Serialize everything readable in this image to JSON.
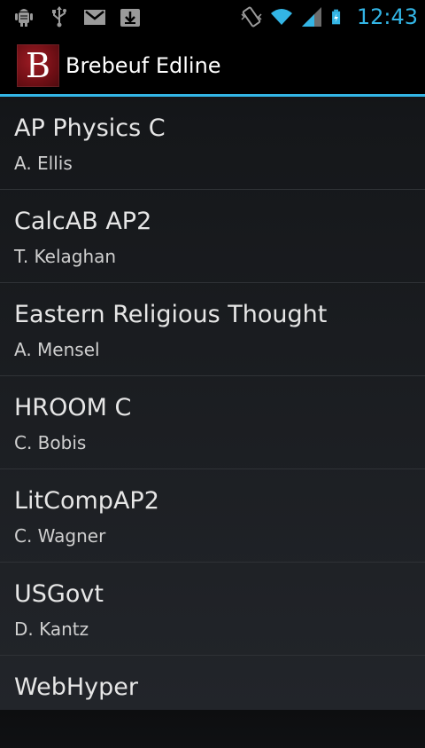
{
  "status_bar": {
    "icons_left": [
      "android-debug-icon",
      "usb-icon",
      "gmail-icon",
      "download-icon"
    ],
    "icons_right": [
      "vibrate-icon",
      "wifi-icon",
      "signal-icon",
      "battery-charging-icon"
    ],
    "time": "12:43",
    "accent_color": "#33b5e5"
  },
  "action_bar": {
    "logo_letter": "B",
    "title": "Brebeuf Edline"
  },
  "courses": [
    {
      "name": "AP Physics C",
      "teacher": "A. Ellis"
    },
    {
      "name": "CalcAB AP2",
      "teacher": "T. Kelaghan"
    },
    {
      "name": "Eastern Religious Thought",
      "teacher": "A. Mensel"
    },
    {
      "name": "HROOM C",
      "teacher": "C. Bobis"
    },
    {
      "name": "LitCompAP2",
      "teacher": "C. Wagner"
    },
    {
      "name": "USGovt",
      "teacher": "D. Kantz"
    },
    {
      "name": "WebHyper",
      "teacher": ""
    }
  ]
}
